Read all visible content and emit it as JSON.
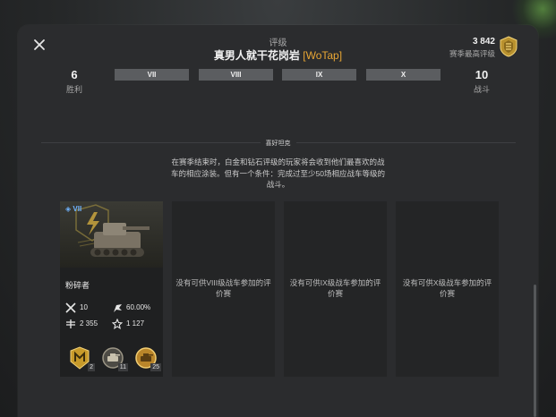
{
  "header": {
    "title_label": "评级",
    "player_name": "真男人就干花岗岩",
    "clan_tag": "[WoTap]",
    "season_best_value": "3 842",
    "season_best_label": "赛季最高评级"
  },
  "stats": {
    "wins_value": "6",
    "wins_label": "胜利",
    "battles_value": "10",
    "battles_label": "战斗"
  },
  "tier_tabs": [
    "VII",
    "VIII",
    "IX",
    "X"
  ],
  "section": {
    "heading": "喜好坦克",
    "description": "在赛季结束时，白金和钻石评级的玩家将会收到他们最喜欢的战车的相应涂装。但有一个条件：完成过至少50场相应战车等级的战斗。"
  },
  "tank_card": {
    "tier": "VII",
    "name": "粉碎者",
    "battles": "10",
    "win_rate": "60.00%",
    "avg_damage": "2 355",
    "rating": "1 127",
    "medals": [
      {
        "icon": "mastery-medal-icon",
        "count": "2"
      },
      {
        "icon": "tank-medal-icon",
        "count": "11"
      },
      {
        "icon": "gold-tank-medal-icon",
        "count": "25"
      }
    ]
  },
  "empty_slots": [
    "没有可供VIII级战车参加的评价赛",
    "没有可供IX级战车参加的评价赛",
    "没有可供X级战车参加的评价赛"
  ],
  "colors": {
    "accent": "#e8a634",
    "tier_tab_bg": "#5b5d60",
    "tier_badge": "#6fb3ff",
    "panel_bg": "#2b2c2e"
  }
}
